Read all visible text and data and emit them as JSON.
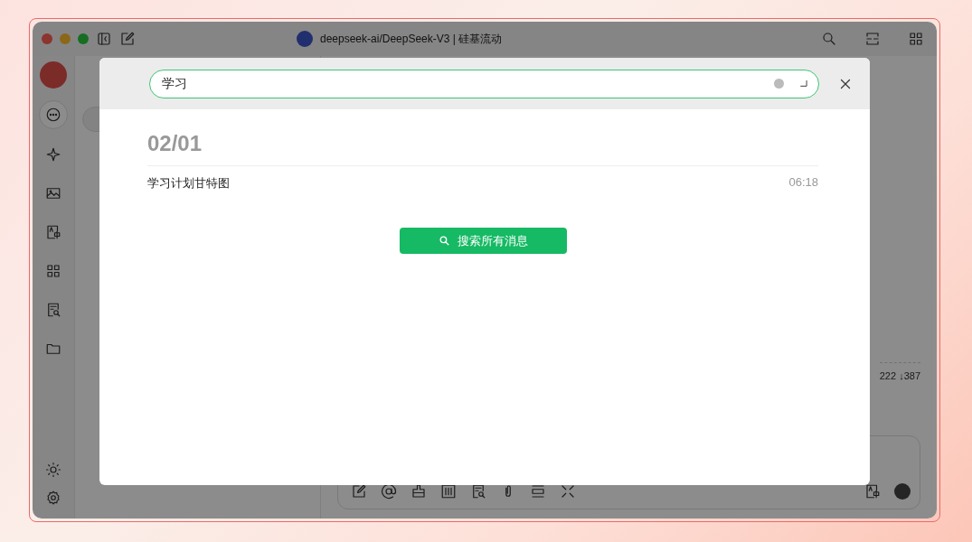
{
  "window": {
    "title": "deepseek-ai/DeepSeek-V3 | 硅基流动"
  },
  "nav_rail": [
    {
      "kind": "chat",
      "selected": true
    },
    {
      "kind": "sparkle",
      "selected": false
    },
    {
      "kind": "image",
      "selected": false
    },
    {
      "kind": "translate",
      "selected": false
    },
    {
      "kind": "grid",
      "selected": false
    },
    {
      "kind": "doc-search",
      "selected": false
    },
    {
      "kind": "folder",
      "selected": false
    }
  ],
  "chat": {
    "token_count": "222 ↓387"
  },
  "search_dialog": {
    "query": "学习",
    "groups": [
      {
        "date": "02/01",
        "results": [
          {
            "title": "学习计划甘特图",
            "time": "06:18"
          }
        ]
      }
    ],
    "search_all_button": "搜索所有消息"
  }
}
